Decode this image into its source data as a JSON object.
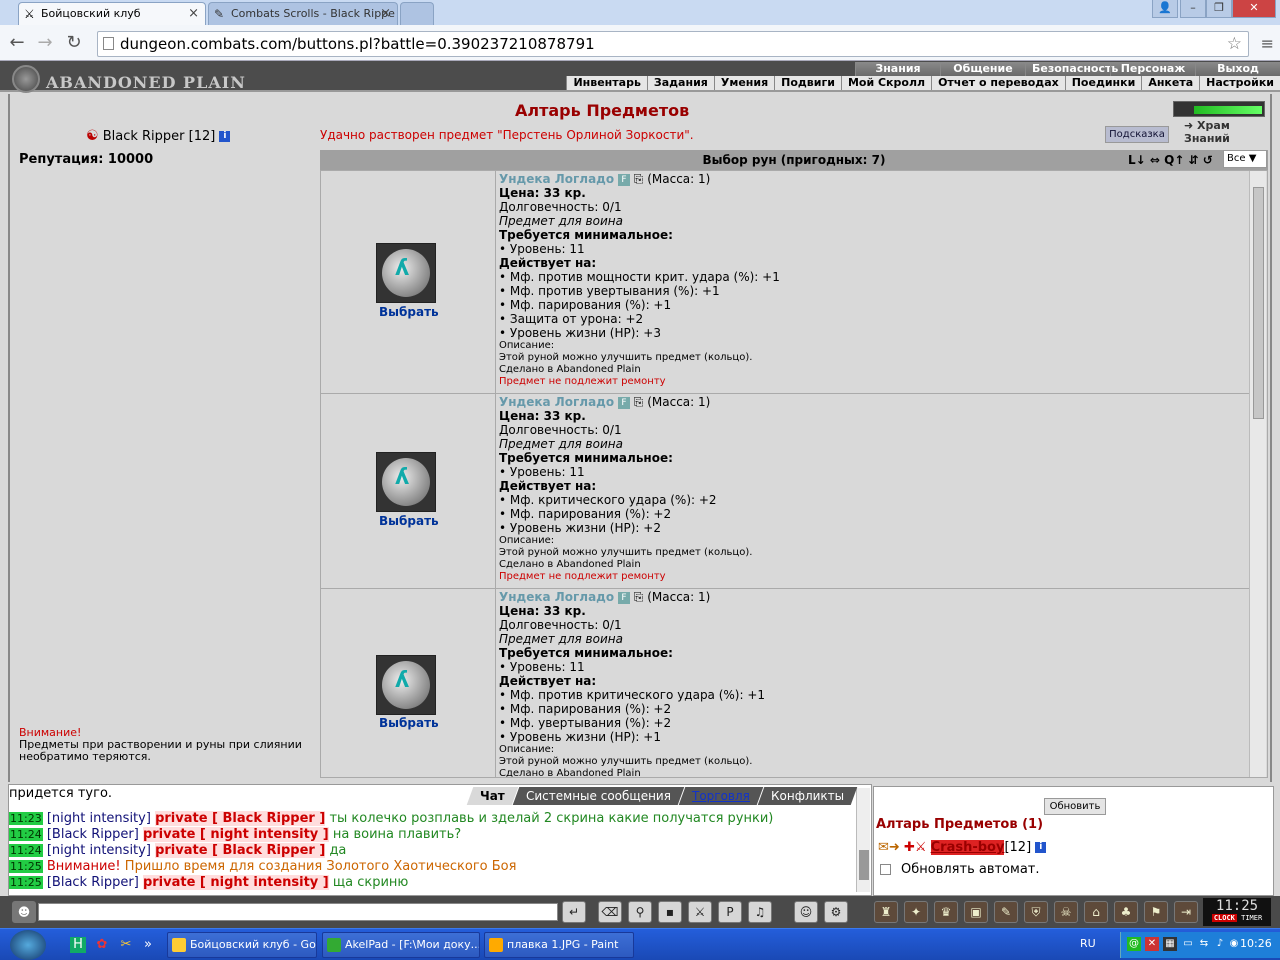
{
  "browser": {
    "tabs": [
      {
        "title": "Бойцовский клуб",
        "close": "×"
      },
      {
        "title": "Combats Scrolls - Black Rippe",
        "close": "×"
      }
    ],
    "window_controls": [
      "👤",
      "–",
      "❐",
      "✕"
    ],
    "url": "dungeon.combats.com/buttons.pl?battle=0.390237210878791",
    "back": "←",
    "forward": "→",
    "reload": "↻",
    "star": "☆",
    "menu": "≡"
  },
  "game_header": {
    "logo": "ABANDONED PLAIN",
    "top_menu": [
      "Знания",
      "Общение",
      "Безопасность",
      "Персонаж",
      "Выход"
    ],
    "sub_menu": [
      "Инвентарь",
      "Задания",
      "Умения",
      "Подвиги",
      "Мой Скролл",
      "Отчет о переводах",
      "Поединки",
      "Анкета",
      "Настройки"
    ]
  },
  "left": {
    "char_name": "Black Ripper",
    "char_level": "[12]",
    "info": "i",
    "reputation": "Репутация: 10000",
    "warning_title": "Внимание!",
    "warning_text": "Предметы при растворении и руны при слиянии необратимо теряются."
  },
  "main": {
    "title": "Алтарь Предметов",
    "message": "Удачно растворен предмет \"Перстень Орлиной Зоркости\".",
    "temple": "Храм Знаний",
    "hint_button": "Подсказка",
    "rune_header": "Выбор рун (пригодных: 7)",
    "sort_icons": "L↓ ⇔ Q↑ ⇵ ↺",
    "filter": "Все",
    "choose_label": "Выбрать",
    "items": [
      {
        "name": "Ундека Логладо",
        "badge": "F",
        "mass": "(Масса: 1)",
        "price": "Цена: 33 кр.",
        "durability": "Долговечность: 0/1",
        "for": "Предмет для воина",
        "req_title": "Требуется минимальное:",
        "req": "• Уровень: 11",
        "acts_title": "Действует на:",
        "effects": [
          "• Мф. против мощности крит. удара (%): +1",
          "• Мф. против увертывания (%): +1",
          "• Мф. парирования (%): +1",
          "• Защита от урона: +2",
          "• Уровень жизни (HP): +3"
        ],
        "desc_title": "Описание:",
        "desc": "Этой руной можно улучшить предмет (кольцо).",
        "made": "Сделано в Abandoned Plain",
        "norepair": "Предмет не подлежит ремонту"
      },
      {
        "name": "Ундека Логладо",
        "badge": "F",
        "mass": "(Масса: 1)",
        "price": "Цена: 33 кр.",
        "durability": "Долговечность: 0/1",
        "for": "Предмет для воина",
        "req_title": "Требуется минимальное:",
        "req": "• Уровень: 11",
        "acts_title": "Действует на:",
        "effects": [
          "• Мф. критического удара (%): +2",
          "• Мф. парирования (%): +2",
          "• Уровень жизни (HP): +2"
        ],
        "desc_title": "Описание:",
        "desc": "Этой руной можно улучшить предмет (кольцо).",
        "made": "Сделано в Abandoned Plain",
        "norepair": "Предмет не подлежит ремонту"
      },
      {
        "name": "Ундека Логладо",
        "badge": "F",
        "mass": "(Масса: 1)",
        "price": "Цена: 33 кр.",
        "durability": "Долговечность: 0/1",
        "for": "Предмет для воина",
        "req_title": "Требуется минимальное:",
        "req": "• Уровень: 11",
        "acts_title": "Действует на:",
        "effects": [
          "• Мф. против критического удара (%): +1",
          "• Мф. парирования (%): +2",
          "• Мф. увертывания (%): +2",
          "• Уровень жизни (HP): +1"
        ],
        "desc_title": "Описание:",
        "desc": "Этой руной можно улучшить предмет (кольцо).",
        "made": "Сделано в Abandoned Plain",
        "norepair": ""
      }
    ]
  },
  "chat": {
    "tabs": [
      "Чат",
      "Системные сообщения",
      "Торговля",
      "Конфликты"
    ],
    "line0": "придется туго.",
    "lines": [
      {
        "time": "11:23",
        "from": "[night intensity]",
        "priv": "private [ Black Ripper ]",
        "text": "ты колечко розплавь и зделай 2 скрина какие получатся рунки)"
      },
      {
        "time": "11:24",
        "from": "[Black Ripper]",
        "priv": "private [ night intensity ]",
        "text": "на воина плавить?"
      },
      {
        "time": "11:24",
        "from": "[night intensity]",
        "priv": "private [ Black Ripper ]",
        "text": "да"
      },
      {
        "time": "11:25",
        "from": "Внимание!",
        "priv": "",
        "text": "Пришло время для создания Золотого Хаотического Боя"
      },
      {
        "time": "11:25",
        "from": "[Black Ripper]",
        "priv": "private [ night intensity ]",
        "text": "ща скриню"
      }
    ]
  },
  "right_panel": {
    "refresh": "Обновить",
    "title": "Алтарь Предметов (1)",
    "user": "Crash-boy",
    "level": "[12]",
    "auto": "Обновлять автомат."
  },
  "bottom_bar": {
    "clock": "11:25",
    "clock_label": "CLOCK",
    "timer_label": "TIMER"
  },
  "taskbar": {
    "tasks": [
      "Бойцовский клуб - Go...",
      "AkelPad - [F:\\Мои доку...",
      "плавка 1.JPG - Paint"
    ],
    "lang": "RU",
    "time": "10:26"
  }
}
